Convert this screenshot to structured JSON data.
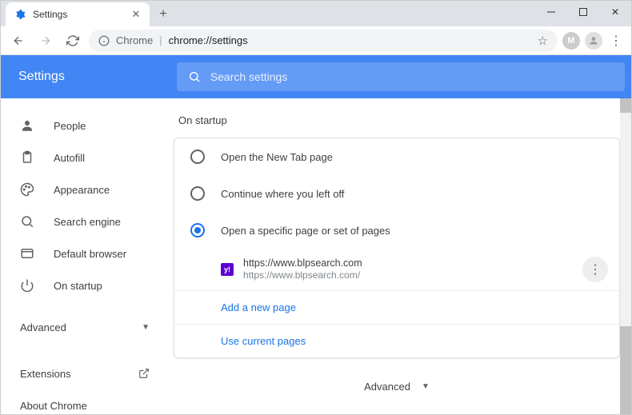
{
  "window": {
    "tab_title": "Settings"
  },
  "omnibox": {
    "scheme_label": "Chrome",
    "url": "chrome://settings",
    "avatar_letter": "M"
  },
  "header": {
    "title": "Settings",
    "search_placeholder": "Search settings"
  },
  "sidebar": {
    "items": [
      {
        "label": "People"
      },
      {
        "label": "Autofill"
      },
      {
        "label": "Appearance"
      },
      {
        "label": "Search engine"
      },
      {
        "label": "Default browser"
      },
      {
        "label": "On startup"
      }
    ],
    "advanced": "Advanced",
    "extensions": "Extensions",
    "about": "About Chrome"
  },
  "main": {
    "section_title": "On startup",
    "radios": [
      {
        "label": "Open the New Tab page",
        "selected": false
      },
      {
        "label": "Continue where you left off",
        "selected": false
      },
      {
        "label": "Open a specific page or set of pages",
        "selected": true
      }
    ],
    "startup_page": {
      "title": "https://www.blpsearch.com",
      "url": "https://www.blpsearch.com/",
      "favicon_letter": "y!"
    },
    "add_page": "Add a new page",
    "use_current": "Use current pages",
    "advanced_label": "Advanced"
  }
}
